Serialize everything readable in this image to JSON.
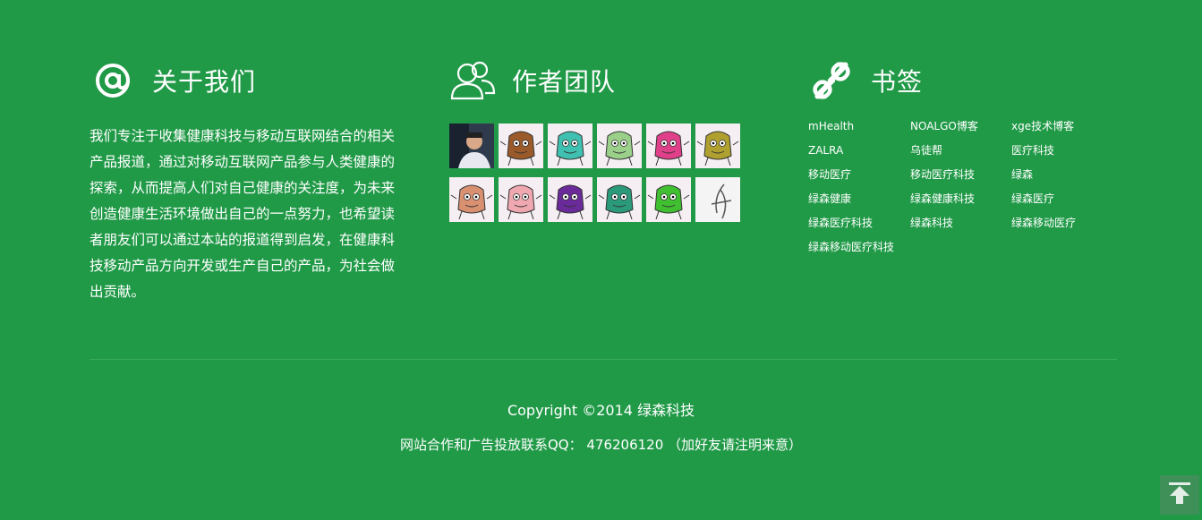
{
  "colors": {
    "background": "#219a48",
    "text": "#ffffff",
    "divider": "#3aab5b",
    "back_to_top_bg": "#3f8f59",
    "back_to_top_arrow": "#e3efe6"
  },
  "about": {
    "icon": "at-icon",
    "title": "关于我们",
    "text": "我们专注于收集健康科技与移动互联网结合的相关产品报道，通过对移动互联网产品参与人类健康的探索，从而提高人们对自己健康的关注度，为未来创造健康生活环境做出自己的一点努力，也希望读者朋友们可以通过本站的报道得到启发，在健康科技移动产品方向开发或生产自己的产品，为社会做出贡献。"
  },
  "team": {
    "icon": "users-icon",
    "title": "作者团队",
    "avatars": [
      {
        "kind": "photo-person",
        "color": "#4a6a8f"
      },
      {
        "kind": "monster",
        "color": "#9a5a2a"
      },
      {
        "kind": "monster",
        "color": "#3fc0b0"
      },
      {
        "kind": "monster",
        "color": "#9ad08a"
      },
      {
        "kind": "monster",
        "color": "#e0408a"
      },
      {
        "kind": "monster",
        "color": "#b0a030"
      },
      {
        "kind": "monster",
        "color": "#d89070"
      },
      {
        "kind": "monster",
        "color": "#f0a8b0"
      },
      {
        "kind": "monster",
        "color": "#6a2a9a"
      },
      {
        "kind": "monster",
        "color": "#2a9a7a"
      },
      {
        "kind": "monster",
        "color": "#40c030"
      },
      {
        "kind": "sketch",
        "color": "#888888"
      }
    ]
  },
  "bookmarks": {
    "icon": "link-icon",
    "title": "书签",
    "links": [
      "mHealth",
      "NOALGO博客",
      "xge技术博客",
      "ZALRA",
      "乌徒帮",
      "医疗科技",
      "移动医疗",
      "移动医疗科技",
      "绿森",
      "绿森健康",
      "绿森健康科技",
      "绿森医疗",
      "绿森医疗科技",
      "绿森科技",
      "绿森移动医疗",
      "绿森移动医疗科技"
    ]
  },
  "footer": {
    "copyright": "Copyright ©2014 绿森科技",
    "contact": "网站合作和广告投放联系QQ： 476206120 （加好友请注明来意）"
  },
  "back_to_top": {
    "icon": "back-to-top-icon"
  }
}
